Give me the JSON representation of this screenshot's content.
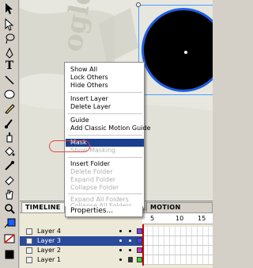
{
  "toolbar": {
    "tools": [
      "selection-arrow",
      "subselection",
      "lasso",
      "pen",
      "text",
      "line",
      "oval",
      "pencil",
      "brush",
      "ink-bottle",
      "paint-bucket",
      "eyedropper",
      "eraser",
      "hand",
      "zoom"
    ],
    "stroke_color": "#1a5fff",
    "fill_color": "#ff0000"
  },
  "stage": {
    "circle_fill": "#000000",
    "circle_stroke": "#1d5fe0"
  },
  "context_menu": {
    "items": [
      {
        "label": "Show All",
        "disabled": false
      },
      {
        "label": "Lock Others",
        "disabled": false
      },
      {
        "label": "Hide Others",
        "disabled": false
      },
      {
        "label": "Insert Layer",
        "disabled": false
      },
      {
        "label": "Delete Layer",
        "disabled": false
      },
      {
        "label": "Guide",
        "disabled": false
      },
      {
        "label": "Add Classic Motion Guide",
        "disabled": false
      },
      {
        "label": "Mask",
        "disabled": false,
        "highlighted": true
      },
      {
        "label": "Show Masking",
        "disabled": true
      },
      {
        "label": "Insert Folder",
        "disabled": false
      },
      {
        "label": "Delete Folder",
        "disabled": true
      },
      {
        "label": "Expand Folder",
        "disabled": true
      },
      {
        "label": "Collapse Folder",
        "disabled": true
      },
      {
        "label": "Expand All Folders",
        "disabled": true
      },
      {
        "label": "Collapse All Folders",
        "disabled": true
      },
      {
        "label": "Properties...",
        "disabled": false
      }
    ]
  },
  "timeline": {
    "tab_label": "TIMELINE",
    "motion_tab_label": "MOTION EDITOR",
    "frame_numbers": [
      "5",
      "10",
      "15"
    ],
    "layers": [
      {
        "name": "Layer 4",
        "color": "#8b3cff",
        "selected": false
      },
      {
        "name": "Layer 3",
        "color": "#4444ff",
        "selected": true
      },
      {
        "name": "Layer 2",
        "color": "#cc33cc",
        "selected": false
      },
      {
        "name": "Layer 1",
        "color": "#33cc33",
        "selected": false
      }
    ]
  }
}
